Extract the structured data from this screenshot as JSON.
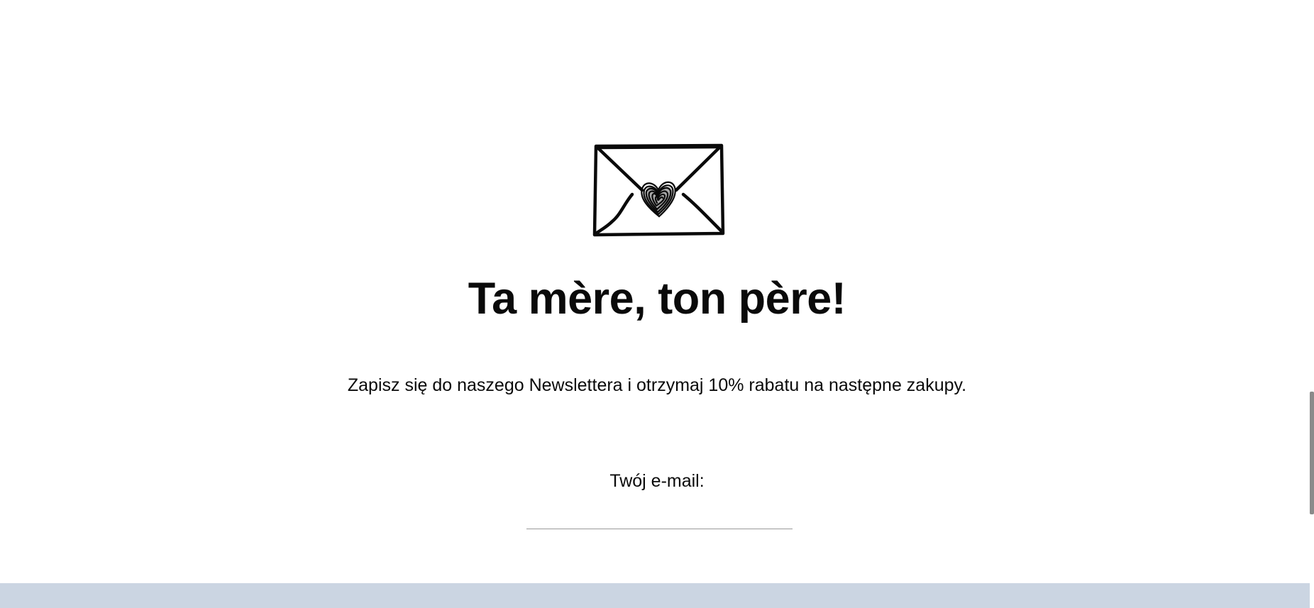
{
  "newsletter": {
    "title": "Ta mère, ton père!",
    "description": "Zapisz się do naszego Newslettera i otrzymaj 10% rabatu na następne zakupy.",
    "email_label": "Twój e-mail:",
    "email_value": "",
    "email_placeholder": "",
    "icon": "envelope-heart-icon"
  },
  "colors": {
    "footer_band": "#cbd5e2",
    "text": "#0a0a0a",
    "input_underline": "#9a9a9a"
  }
}
